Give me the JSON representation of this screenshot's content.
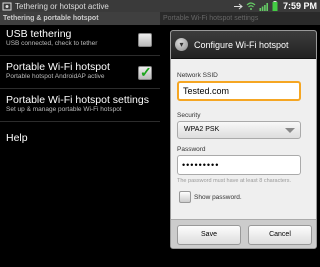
{
  "left": {
    "statusbar": {
      "text": "Tethering or hotspot active"
    },
    "title": "Tethering & portable hotspot",
    "prefs": [
      {
        "title": "USB tethering",
        "summary": "USB connected, check to tether",
        "checked": false
      },
      {
        "title": "Portable Wi-Fi hotspot",
        "summary": "Portable hotspot AndroidAP active",
        "checked": true
      },
      {
        "title": "Portable Wi-Fi hotspot settings",
        "summary": "Set up & manage portable Wi-Fi hotspot"
      },
      {
        "title": "Help",
        "summary": ""
      }
    ]
  },
  "right": {
    "statusbar": {
      "clock": "7:59 PM"
    },
    "title": "Portable Wi-Fi hotspot settings",
    "dialog": {
      "title": "Configure Wi-Fi hotspot",
      "ssid_label": "Network SSID",
      "ssid_value": "Tested.com",
      "security_label": "Security",
      "security_value": "WPA2 PSK",
      "password_label": "Password",
      "password_value": "•••••••••",
      "password_hint": "The password must have at least 8 characters.",
      "show_password": "Show password.",
      "save": "Save",
      "cancel": "Cancel"
    }
  }
}
